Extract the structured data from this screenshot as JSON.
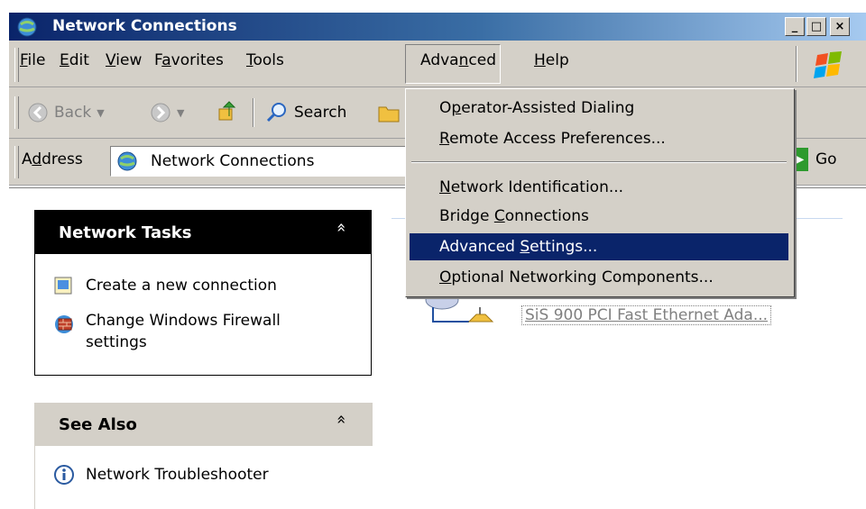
{
  "window": {
    "title": "Network Connections",
    "minimize": "_",
    "maximize": "□",
    "close": "×"
  },
  "menubar": {
    "items": [
      {
        "pre": "",
        "key": "F",
        "post": "ile"
      },
      {
        "pre": "",
        "key": "E",
        "post": "dit"
      },
      {
        "pre": "",
        "key": "V",
        "post": "iew"
      },
      {
        "pre": "F",
        "key": "a",
        "post": "vorites"
      },
      {
        "pre": "",
        "key": "T",
        "post": "ools"
      },
      {
        "pre": "Adva",
        "key": "n",
        "post": "ced"
      },
      {
        "pre": "",
        "key": "H",
        "post": "elp"
      }
    ]
  },
  "toolbar": {
    "back": "Back",
    "search": "Search"
  },
  "addressbar": {
    "label_pre": "A",
    "label_key": "d",
    "label_post": "dress",
    "value": "Network Connections",
    "go": "Go"
  },
  "network_tasks": {
    "title": "Network Tasks",
    "collapse": "«",
    "items": [
      {
        "label": "Create a new connection"
      },
      {
        "label": "Change Windows Firewall settings",
        "line1": "Change Windows Firewall",
        "line2": "settings"
      }
    ]
  },
  "see_also": {
    "title": "See Also",
    "collapse": "«",
    "items": [
      {
        "label": "Network Troubleshooter"
      }
    ]
  },
  "connection": {
    "device": "SiS 900 PCI Fast Ethernet Ada..."
  },
  "advanced_menu": {
    "items": [
      {
        "pre": "O",
        "key": "p",
        "post": "erator-Assisted Dialing"
      },
      {
        "pre": "",
        "key": "R",
        "post": "emote Access Preferences..."
      },
      {
        "pre": "",
        "key": "N",
        "post": "etwork Identification..."
      },
      {
        "pre": "Bridge ",
        "key": "C",
        "post": "onnections"
      },
      {
        "pre": "Advanced ",
        "key": "S",
        "post": "ettings..."
      },
      {
        "pre": "",
        "key": "O",
        "post": "ptional Networking Components..."
      }
    ],
    "selected_index": 4
  },
  "colors": {
    "title_gradient_start": "#0a246a",
    "chrome": "#d4d0c8",
    "highlight": "#0a246a"
  }
}
